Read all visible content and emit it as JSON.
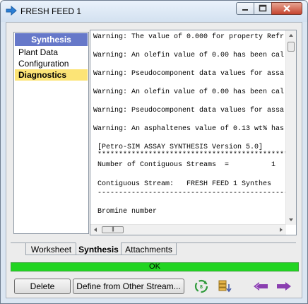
{
  "window": {
    "title": "FRESH FEED 1"
  },
  "nav": {
    "header": "Synthesis",
    "items": [
      {
        "label": "Plant Data"
      },
      {
        "label": "Configuration"
      },
      {
        "label": "Diagnostics",
        "active": true
      }
    ]
  },
  "log": {
    "lines": [
      "Warning: The value of 0.000 for property Refr",
      "Warning: An olefin value of 0.00 has been cal",
      "Warning: Pseudocomponent data values for assa",
      "Warning: An olefin value of 0.00 has been cal",
      "Warning: Pseudocomponent data values for assa",
      "Warning: An asphaltenes value of 0.13 wt% has",
      " [Petro-SIM ASSAY SYNTHESIS Version 5.0]",
      " *********************************************",
      " Number of Contiguous Streams  =          1",
      " Contiguous Stream:   FRESH FEED 1 Synthes",
      " ---------------------------------------------",
      " Bromine number"
    ]
  },
  "tabs": [
    {
      "label": "Worksheet"
    },
    {
      "label": "Synthesis",
      "active": true
    },
    {
      "label": "Attachments"
    }
  ],
  "status": {
    "text": "OK",
    "color": "#21d421"
  },
  "buttons": {
    "delete": "Delete",
    "define": "Define from Other Stream..."
  },
  "icons": {
    "title": "arrow-right-icon",
    "toolbar": [
      "recycle-icon",
      "database-stack-icon",
      "previous-arrow-icon",
      "next-arrow-icon"
    ]
  }
}
